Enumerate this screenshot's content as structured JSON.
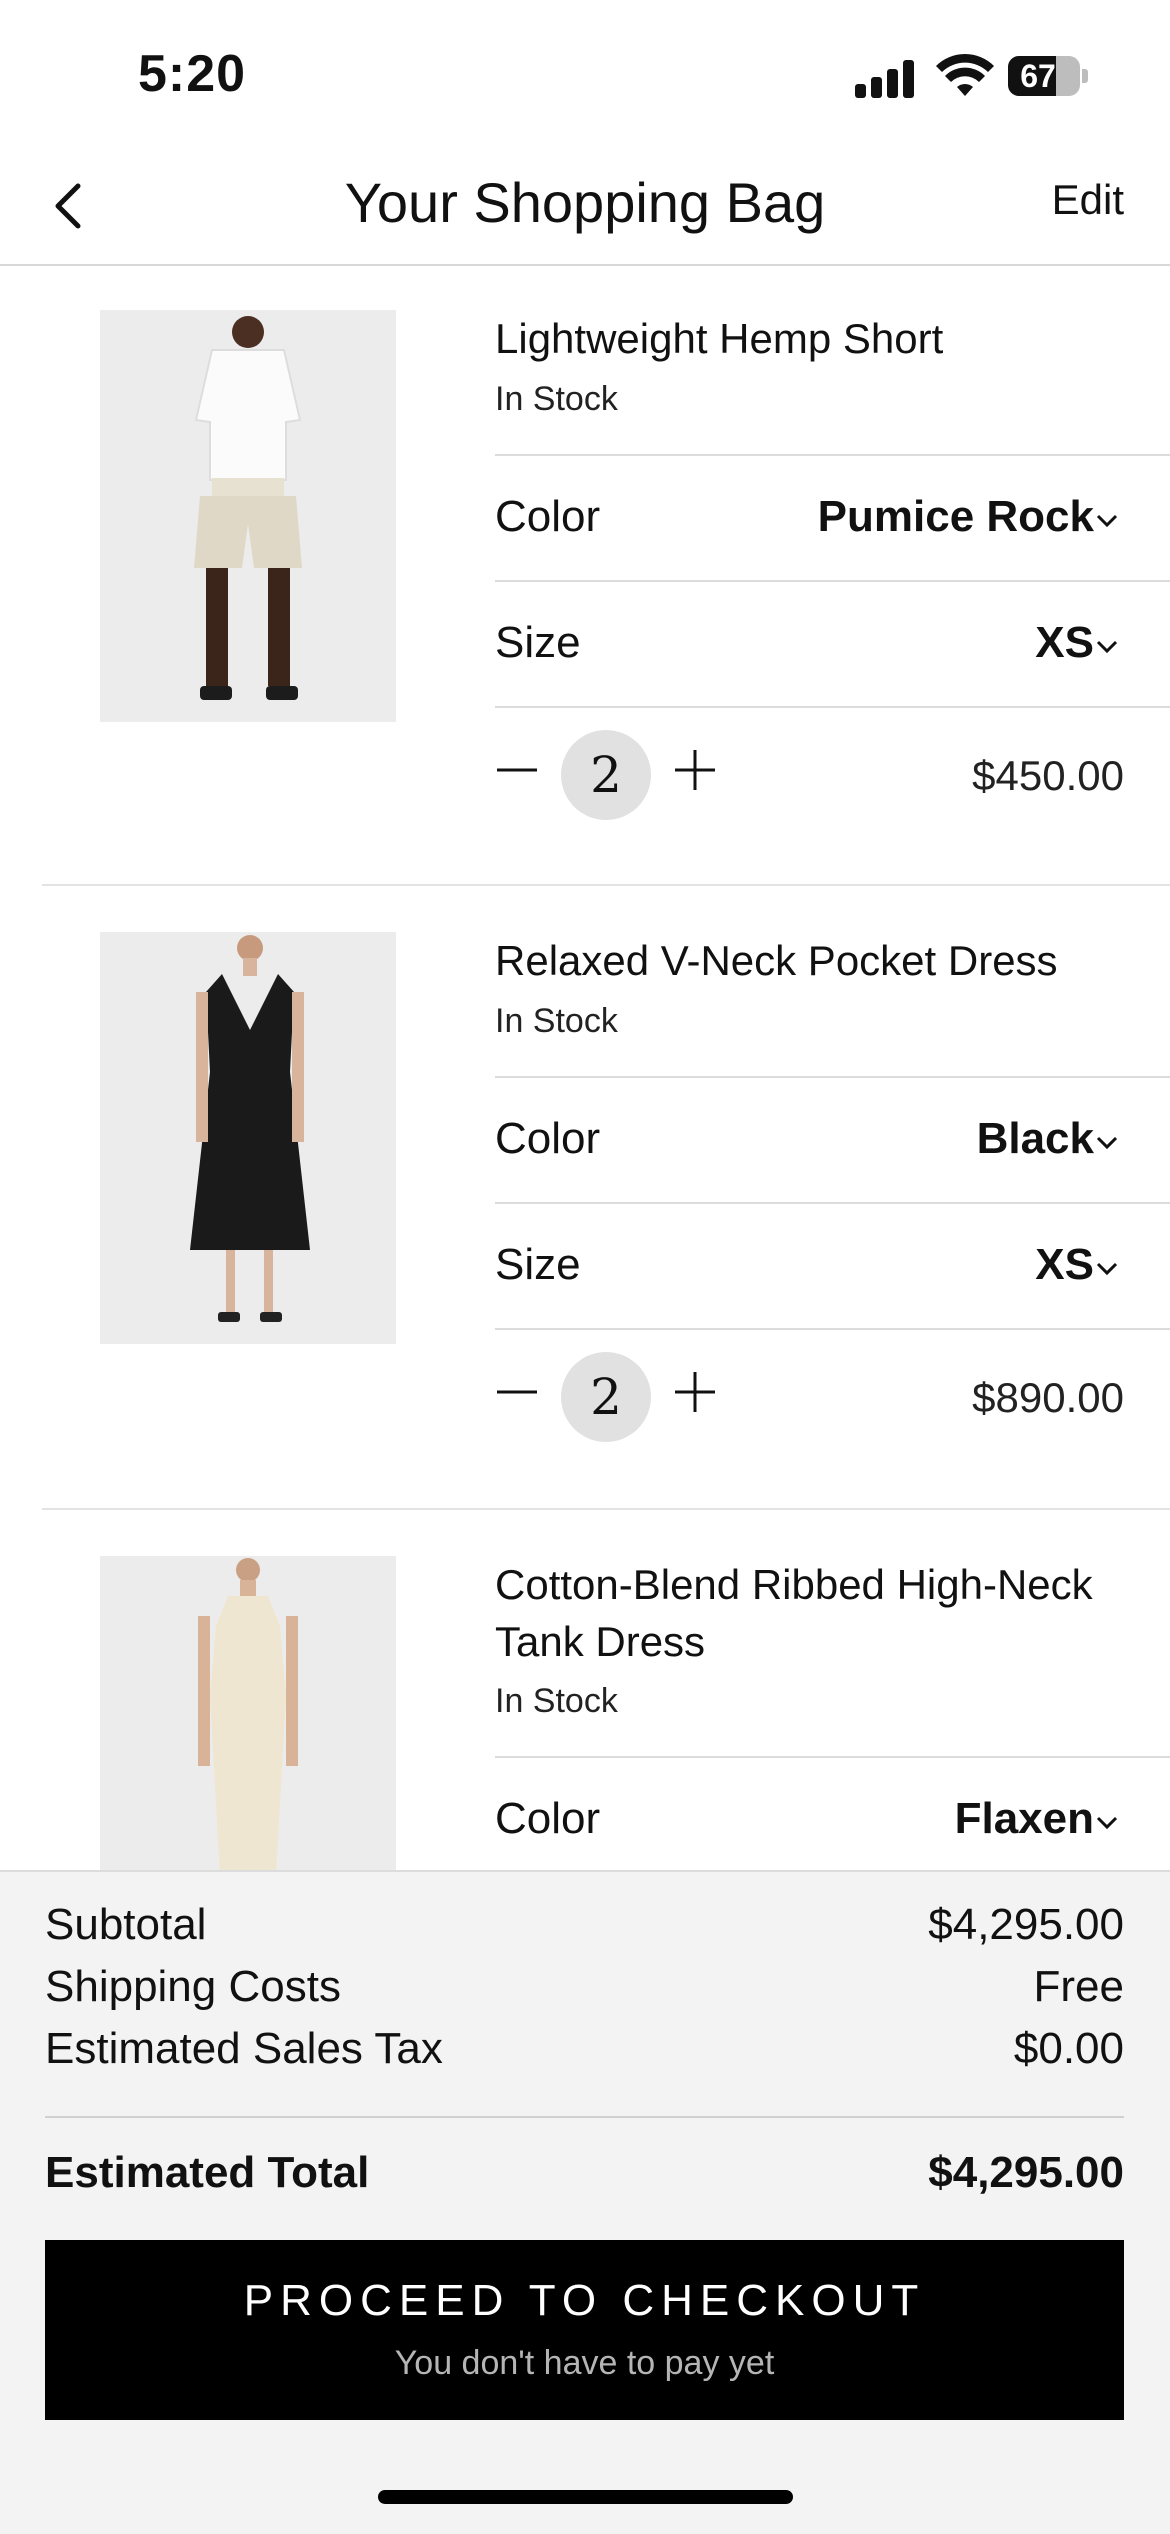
{
  "status_bar": {
    "time": "5:20",
    "battery": "67",
    "battery_level": 0.67
  },
  "nav": {
    "title": "Your Shopping Bag",
    "edit_label": "Edit"
  },
  "items": [
    {
      "name": "Lightweight Hemp Short",
      "stock": "In Stock",
      "color_label": "Color",
      "color_value": "Pumice Rock",
      "size_label": "Size",
      "size_value": "XS",
      "quantity": "2",
      "price": "$450.00"
    },
    {
      "name": "Relaxed V-Neck Pocket Dress",
      "stock": "In Stock",
      "color_label": "Color",
      "color_value": "Black",
      "size_label": "Size",
      "size_value": "XS",
      "quantity": "2",
      "price": "$890.00"
    },
    {
      "name": "Cotton-Blend Ribbed High-Neck Tank Dress",
      "stock": "In Stock",
      "color_label": "Color",
      "color_value": "Flaxen"
    }
  ],
  "summary": {
    "subtotal_label": "Subtotal",
    "subtotal_value": "$4,295.00",
    "shipping_label": "Shipping Costs",
    "shipping_value": "Free",
    "tax_label": "Estimated Sales Tax",
    "tax_value": "$0.00",
    "total_label": "Estimated Total",
    "total_value": "$4,295.00"
  },
  "checkout": {
    "label": "PROCEED TO CHECKOUT",
    "sublabel": "You don't have to pay yet"
  },
  "colors": {
    "accent": "#000000",
    "summary_bg": "#f3f3f3",
    "qty_bg": "#e1e1e1"
  }
}
